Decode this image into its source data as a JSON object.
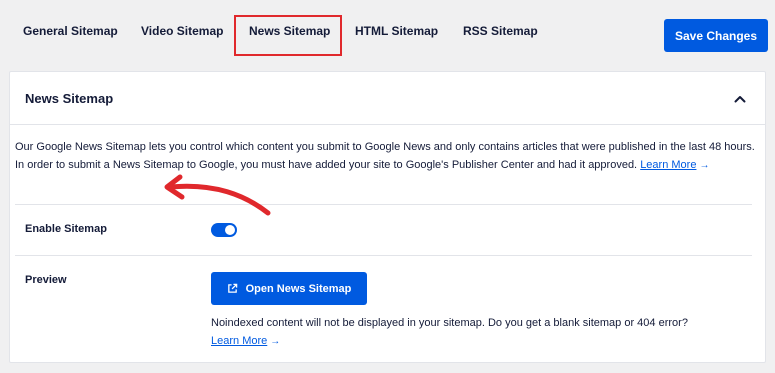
{
  "tabs": [
    {
      "label": "General Sitemap",
      "active": false
    },
    {
      "label": "Video Sitemap",
      "active": false
    },
    {
      "label": "News Sitemap",
      "active": true
    },
    {
      "label": "HTML Sitemap",
      "active": false
    },
    {
      "label": "RSS Sitemap",
      "active": false
    }
  ],
  "toolbar": {
    "save_label": "Save Changes"
  },
  "card": {
    "title": "News Sitemap",
    "description": "Our Google News Sitemap lets you control which content you submit to Google News and only contains articles that were published in the last 48 hours. In order to submit a News Sitemap to Google, you must have added your site to Google's Publisher Center and had it approved.",
    "learn_more_label": "Learn More",
    "arrow_glyph": "→"
  },
  "settings": {
    "enable_label": "Enable Sitemap",
    "enable_value": true,
    "preview_label": "Preview",
    "open_button_label": "Open News Sitemap",
    "note_text": "Noindexed content will not be displayed in your sitemap. Do you get a blank sitemap or 404 error?",
    "note_link_label": "Learn More"
  },
  "colors": {
    "accent": "#005ae0",
    "highlight_box": "#e0282c",
    "annotation_arrow": "#e0282c"
  }
}
